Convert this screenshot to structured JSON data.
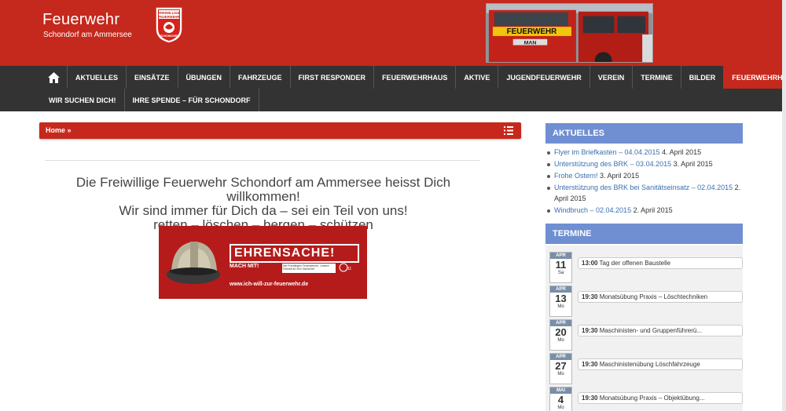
{
  "site": {
    "title": "Feuerwehr",
    "subtitle": "Schondorf am Ammersee",
    "logo_text": [
      "FREIWILLIGE",
      "FEUERWEHR",
      "SCHONDORF"
    ],
    "truck_text": [
      "FEUERWEHR",
      "MAN"
    ],
    "accent_color": "#c5281c"
  },
  "nav": {
    "row1": [
      {
        "label": "AKTUELLES"
      },
      {
        "label": "EINSÄTZE"
      },
      {
        "label": "ÜBUNGEN"
      },
      {
        "label": "FAHRZEUGE"
      },
      {
        "label": "FIRST RESPONDER"
      },
      {
        "label": "FEUERWEHRHAUS"
      },
      {
        "label": "AKTIVE"
      },
      {
        "label": "JUGENDFEUERWEHR"
      },
      {
        "label": "VEREIN"
      },
      {
        "label": "TERMINE"
      },
      {
        "label": "BILDER"
      },
      {
        "label": "FEUERWEHRHAUS-BAU",
        "active": true
      }
    ],
    "row2": [
      {
        "label": "WIR SUCHEN DICH!"
      },
      {
        "label": "IHRE SPENDE – FÜR SCHONDORF"
      }
    ]
  },
  "breadcrumb": "Home »",
  "welcome": {
    "line1": "Die Freiwillige Feuerwehr Schondorf am Ammersee heisst Dich willkommen!",
    "line2": "Wir sind immer für Dich da – sei ein Teil von uns!",
    "line3": "retten – löschen – bergen – schützen"
  },
  "banner": {
    "title": "EHRENSACHE!",
    "subtitle": "MACH MIT!",
    "tag": "Die Freiwilligen Feuerwehren. Unsere Freizeit für Ihre Sicherheit",
    "url": "www.ich-will-zur-feuerwehr.de"
  },
  "aktuelles": {
    "heading": "AKTUELLES",
    "items": [
      {
        "link": "Flyer im Briefkasten – 04.04.2015",
        "date": " 4. April 2015"
      },
      {
        "link": "Unterstützung des BRK – 03.04.2015",
        "date": " 3. April 2015"
      },
      {
        "link": "Frohe Ostern!",
        "date": " 3. April 2015"
      },
      {
        "link": "Unterstützung des BRK bei Sanitätseinsatz – 02.04.2015",
        "date": " 2. April 2015"
      },
      {
        "link": "Windbruch – 02.04.2015",
        "date": " 2. April 2015"
      }
    ]
  },
  "termine": {
    "heading": "TERMINE",
    "events": [
      {
        "month": "APR",
        "day": "11",
        "weekday": "Sa",
        "time": "13:00",
        "title": " Tag der offenen Baustelle"
      },
      {
        "month": "APR",
        "day": "13",
        "weekday": "Mo",
        "time": "19:30",
        "title": " Monatsübung Praxis – Löschtechniken"
      },
      {
        "month": "APR",
        "day": "20",
        "weekday": "Mo",
        "time": "19:30",
        "title": " Maschinisten- und Gruppenführerü..."
      },
      {
        "month": "APR",
        "day": "27",
        "weekday": "Mo",
        "time": "19:30",
        "title": " Maschinistenübung Löschfahrzeuge"
      },
      {
        "month": "MAI",
        "day": "4",
        "weekday": "Mo",
        "time": "19:30",
        "title": " Monatsübung Praxis – Objektübung..."
      }
    ]
  }
}
